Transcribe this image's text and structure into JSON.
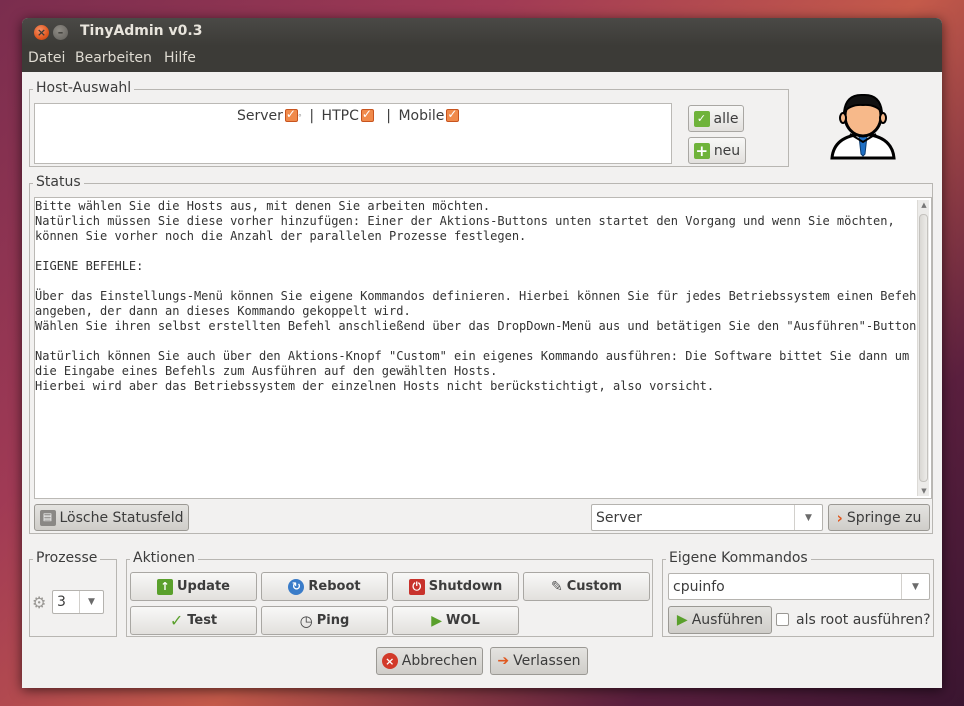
{
  "window": {
    "title": "TinyAdmin v0.3"
  },
  "menu": {
    "items": [
      "Datei",
      "Bearbeiten",
      "Hilfe"
    ]
  },
  "host_selection": {
    "legend": "Host-Auswahl",
    "hosts": [
      {
        "label": "Server",
        "checked": true
      },
      {
        "label": "HTPC",
        "checked": true
      },
      {
        "label": "Mobile",
        "checked": true
      }
    ],
    "separator": "|",
    "btn_all": "alle",
    "btn_new": "neu"
  },
  "status": {
    "legend": "Status",
    "text": "Bitte wählen Sie die Hosts aus, mit denen Sie arbeiten möchten.\nNatürlich müssen Sie diese vorher hinzufügen: Einer der Aktions-Buttons unten startet den Vorgang und wenn Sie möchten,\nkönnen Sie vorher noch die Anzahl der parallelen Prozesse festlegen.\n\nEIGENE BEFEHLE:\n\nÜber das Einstellungs-Menü können Sie eigene Kommandos definieren. Hierbei können Sie für jedes Betriebssystem einen Befehl\nangeben, der dann an dieses Kommando gekoppelt wird.\nWählen Sie ihren selbst erstellten Befehl anschließend über das DropDown-Menü aus und betätigen Sie den \"Ausführen\"-Button.\n\nNatürlich können Sie auch über den Aktions-Knopf \"Custom\" ein eigenes Kommando ausführen: Die Software bittet Sie dann um\ndie Eingabe eines Befehls zum Ausführen auf den gewählten Hosts.\nHierbei wird aber das Betriebssystem der einzelnen Hosts nicht berückstichtigt, also vorsicht.",
    "clear_btn": "Lösche Statusfeld",
    "jump_select": "Server",
    "jump_btn": "Springe zu"
  },
  "processes": {
    "legend": "Prozesse",
    "value": "3"
  },
  "actions": {
    "legend": "Aktionen",
    "buttons": [
      "Update",
      "Reboot",
      "Shutdown",
      "Custom",
      "Test",
      "Ping",
      "WOL"
    ]
  },
  "custom_commands": {
    "legend": "Eigene Kommandos",
    "selected": "cpuinfo",
    "run_btn": "Ausführen",
    "root_label": "als root ausführen?",
    "root_checked": false
  },
  "footer": {
    "cancel": "Abbrechen",
    "leave": "Verlassen"
  },
  "colors": {
    "accent": "#e0581f",
    "titlebar": "#3c3b37",
    "window_bg": "#f2f1f0"
  }
}
